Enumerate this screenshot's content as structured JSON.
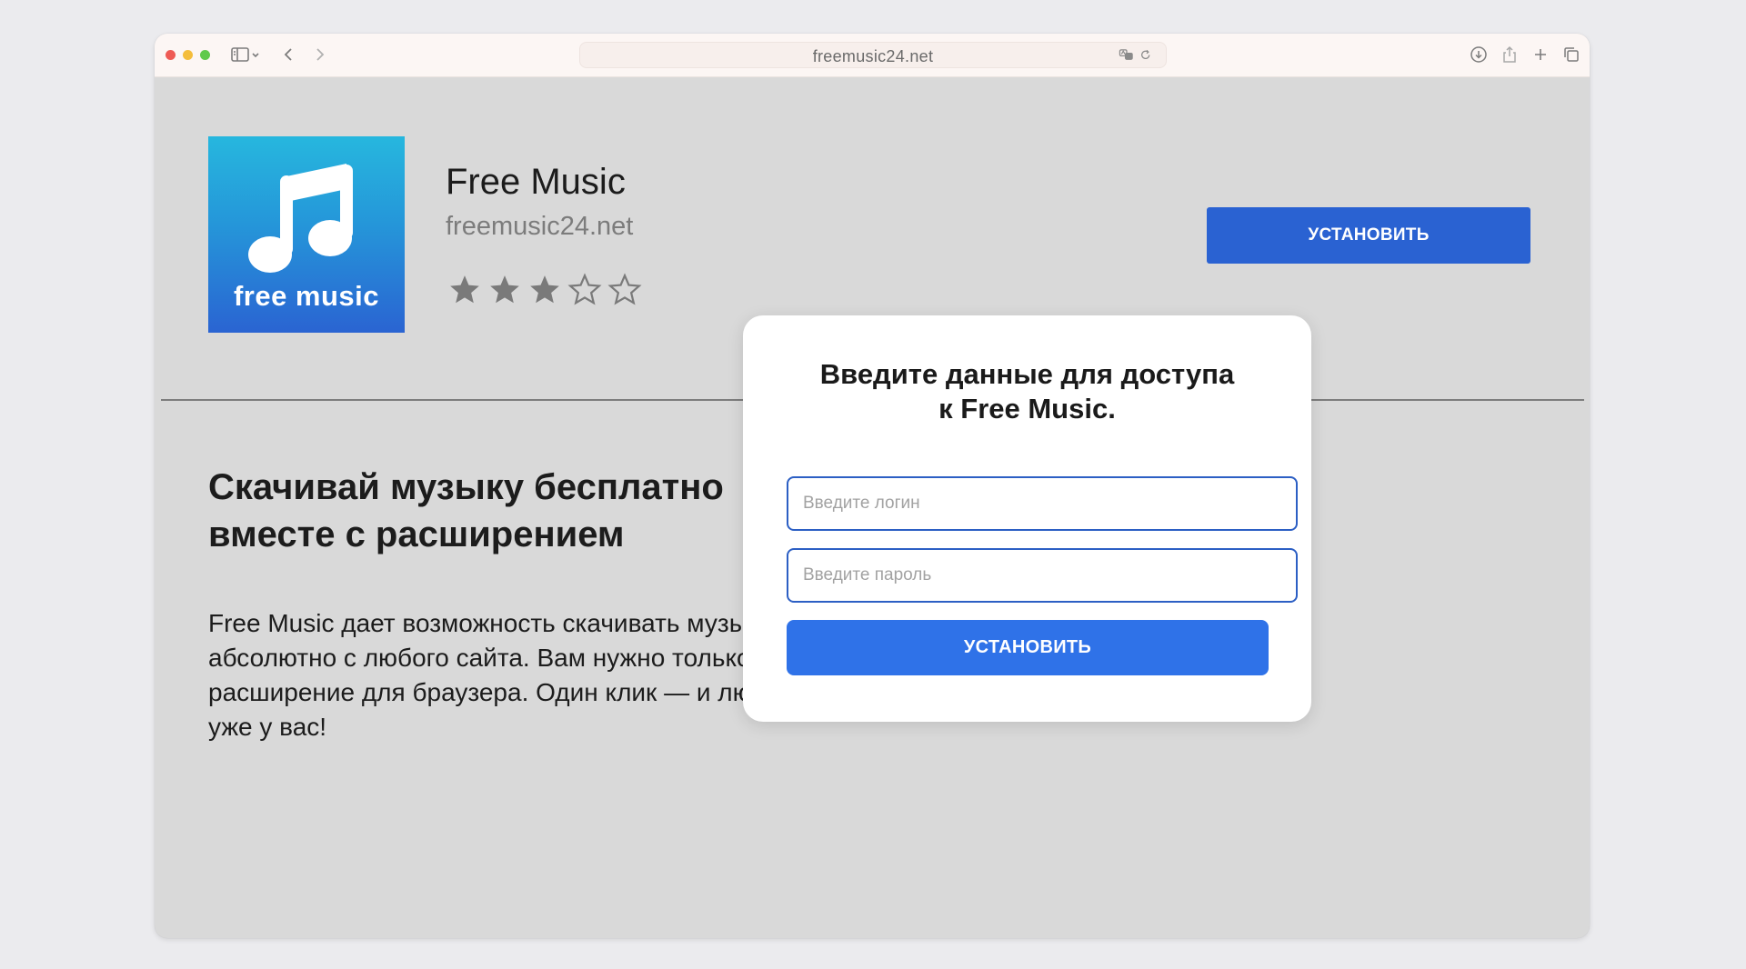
{
  "browser": {
    "url": "freemusic24.net",
    "icons": [
      "sidebar-icon",
      "chevron-down-icon",
      "back-icon",
      "forward-icon",
      "translate-icon",
      "reload-icon",
      "download-icon",
      "share-icon",
      "new-tab-icon",
      "tabs-overview-icon"
    ]
  },
  "app": {
    "icon_label": "free music",
    "title": "Free Music",
    "domain": "freemusic24.net",
    "rating_filled": 3,
    "rating_total": 5,
    "install_label": "УСТАНОВИТЬ"
  },
  "promo": {
    "headline_line1": "Скачивай музыку бесплатно",
    "headline_line2": "вместе с расширением",
    "desc_line1": "Free Music дает возможность скачивать музыку",
    "desc_line2": "абсолютно с любого сайта. Вам нужно только установить",
    "desc_line3": "расширение для браузера. Один клик — и любимая музыка",
    "desc_line4": "уже у вас!"
  },
  "modal": {
    "title_line1": "Введите данные для доступа",
    "title_line2": "к Free Music.",
    "login_placeholder": "Введите логин",
    "password_placeholder": "Введите пароль",
    "install_label": "УСТАНОВИТЬ"
  },
  "colors": {
    "primary_button": "#2a62d2",
    "modal_button": "#2f72e8",
    "field_border": "#2c5fc4",
    "page_background": "#d9d9d9"
  }
}
